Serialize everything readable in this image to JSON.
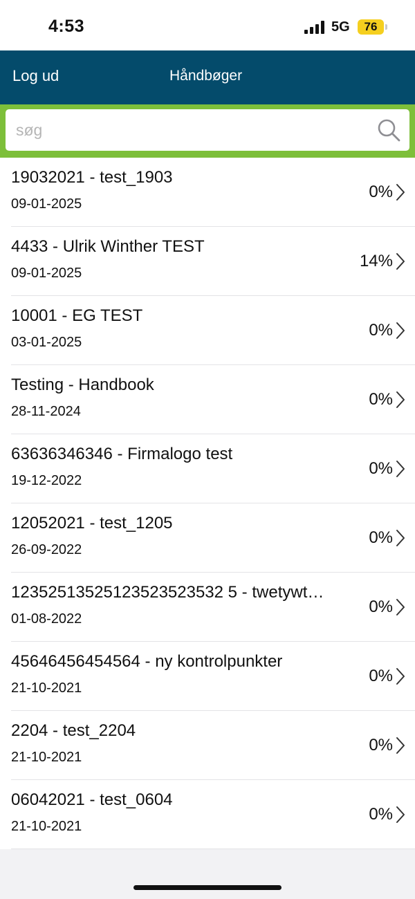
{
  "status_bar": {
    "time": "4:53",
    "network": "5G",
    "battery": "76"
  },
  "nav": {
    "logout_label": "Log ud",
    "title": "Håndbøger"
  },
  "search": {
    "placeholder": "søg",
    "value": ""
  },
  "colors": {
    "nav_background": "#044b6b",
    "search_border": "#7dbf3a",
    "battery_badge": "#f5cf1f"
  },
  "handbooks": [
    {
      "title": "19032021 - test_1903",
      "date": "09-01-2025",
      "progress": "0%"
    },
    {
      "title": "4433 - Ulrik Winther TEST",
      "date": "09-01-2025",
      "progress": "14%"
    },
    {
      "title": "10001 - EG TEST",
      "date": "03-01-2025",
      "progress": "0%"
    },
    {
      "title": "Testing - Handbook",
      "date": "28-11-2024",
      "progress": "0%"
    },
    {
      "title": "63636346346 - Firmalogo test",
      "date": "19-12-2022",
      "progress": "0%"
    },
    {
      "title": "12052021 - test_1205",
      "date": "26-09-2022",
      "progress": "0%"
    },
    {
      "title": "12352513525123523523532 5 - twetywt…",
      "date": "01-08-2022",
      "progress": "0%"
    },
    {
      "title": "45646456454564 - ny kontrolpunkter",
      "date": "21-10-2021",
      "progress": "0%"
    },
    {
      "title": "2204 - test_2204",
      "date": "21-10-2021",
      "progress": "0%"
    },
    {
      "title": "06042021 - test_0604",
      "date": "21-10-2021",
      "progress": "0%"
    }
  ]
}
